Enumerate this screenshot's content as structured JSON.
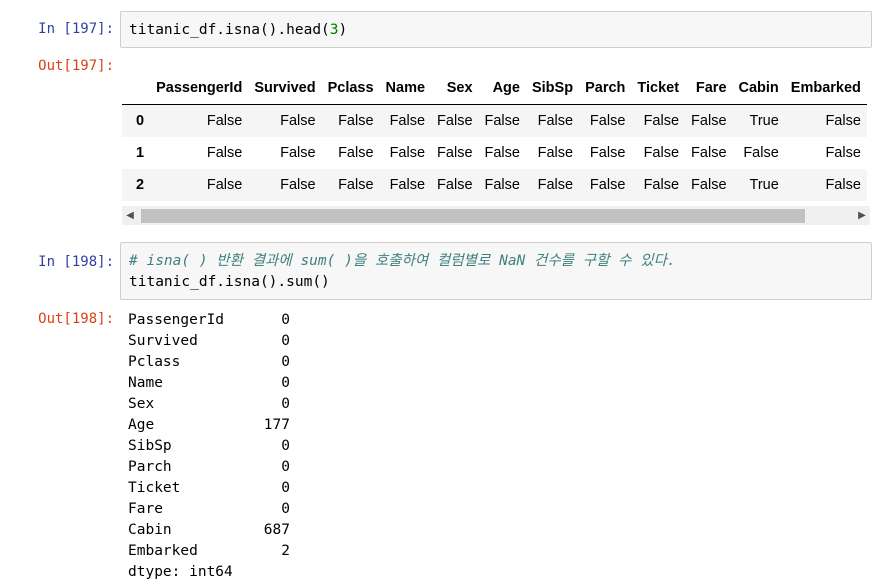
{
  "cells": [
    {
      "in_prompt": "In [197]:",
      "code": "titanic_df.isna().head(",
      "code_num": "3",
      "code_end": ")",
      "out_prompt": "Out[197]:",
      "table": {
        "columns": [
          "",
          "PassengerId",
          "Survived",
          "Pclass",
          "Name",
          "Sex",
          "Age",
          "SibSp",
          "Parch",
          "Ticket",
          "Fare",
          "Cabin",
          "Embarked"
        ],
        "rows": [
          {
            "index": "0",
            "values": [
              "False",
              "False",
              "False",
              "False",
              "False",
              "False",
              "False",
              "False",
              "False",
              "False",
              "True",
              "False"
            ]
          },
          {
            "index": "1",
            "values": [
              "False",
              "False",
              "False",
              "False",
              "False",
              "False",
              "False",
              "False",
              "False",
              "False",
              "False",
              "False"
            ]
          },
          {
            "index": "2",
            "values": [
              "False",
              "False",
              "False",
              "False",
              "False",
              "False",
              "False",
              "False",
              "False",
              "False",
              "True",
              "False"
            ]
          }
        ]
      }
    },
    {
      "in_prompt": "In [198]:",
      "comment": "# isna( ) 반환 결과에 sum( )을 호출하여 컬럼별로 NaN 건수를 구할 수 있다.",
      "code": "titanic_df.isna().sum()",
      "out_prompt": "Out[198]:",
      "series": [
        {
          "key": "PassengerId",
          "value": "0"
        },
        {
          "key": "Survived",
          "value": "0"
        },
        {
          "key": "Pclass",
          "value": "0"
        },
        {
          "key": "Name",
          "value": "0"
        },
        {
          "key": "Sex",
          "value": "0"
        },
        {
          "key": "Age",
          "value": "177"
        },
        {
          "key": "SibSp",
          "value": "0"
        },
        {
          "key": "Parch",
          "value": "0"
        },
        {
          "key": "Ticket",
          "value": "0"
        },
        {
          "key": "Fare",
          "value": "0"
        },
        {
          "key": "Cabin",
          "value": "687"
        },
        {
          "key": "Embarked",
          "value": "2"
        }
      ],
      "dtype": "dtype: int64"
    }
  ],
  "scrollbar": {
    "left_arrow": "◀",
    "right_arrow": "▶"
  }
}
